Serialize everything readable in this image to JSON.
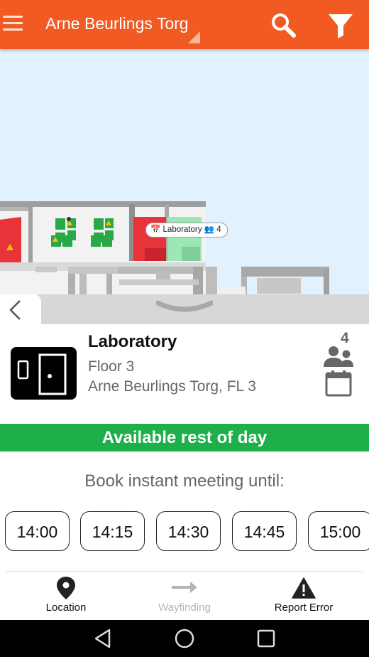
{
  "app_bar": {
    "title": "Arne Beurlings Torg",
    "menu_icon": "hamburger-menu-icon",
    "search_icon": "search-icon",
    "filter_icon": "filter-icon",
    "color": "#f15a22"
  },
  "map": {
    "room_label": "Laboratory",
    "room_capacity": "4",
    "background": "#e1f1fe"
  },
  "room": {
    "name": "Laboratory",
    "floor": "Floor 3",
    "address": "Arne Beurlings Torg, FL 3",
    "capacity": "4",
    "icon": "door-icon"
  },
  "status": {
    "text": "Available rest of day",
    "color": "#1db04a"
  },
  "booking": {
    "label": "Book instant meeting until:",
    "times": [
      "14:00",
      "14:15",
      "14:30",
      "14:45",
      "15:00"
    ]
  },
  "bottom_nav": {
    "location": "Location",
    "wayfinding": "Wayfinding",
    "report_error": "Report Error"
  },
  "system_nav": {
    "back": "back-icon",
    "home": "home-icon",
    "recents": "recents-icon"
  }
}
